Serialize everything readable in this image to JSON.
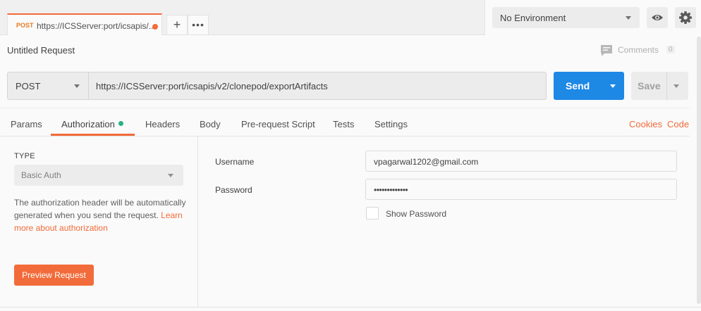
{
  "tab": {
    "method": "POST",
    "url": "https://ICSServer:port/icsapis/...",
    "unsaved_dot_color": "#f26b3a"
  },
  "tab_add_label": "+",
  "tab_more_label": "•••",
  "environment": {
    "selected": "No Environment"
  },
  "request": {
    "title": "Untitled Request",
    "comments_label": "Comments",
    "comments_count": "0",
    "method": "POST",
    "url": "https://ICSServer:port/icsapis/v2/clonepod/exportArtifacts",
    "send_label": "Send",
    "save_label": "Save"
  },
  "request_tabs": [
    {
      "label": "Params"
    },
    {
      "label": "Authorization"
    },
    {
      "label": "Headers"
    },
    {
      "label": "Body"
    },
    {
      "label": "Pre-request Script"
    },
    {
      "label": "Tests"
    },
    {
      "label": "Settings"
    }
  ],
  "active_tab": "Authorization",
  "right_links": {
    "cookies": "Cookies",
    "code": "Code"
  },
  "auth": {
    "type_label": "TYPE",
    "type_selected": "Basic Auth",
    "help_text": "The authorization header will be automatically generated when you send the request. ",
    "help_link": "Learn more about authorization",
    "preview_label": "Preview Request",
    "username_label": "Username",
    "username_value": "vpagarwal1202@gmail.com",
    "password_label": "Password",
    "password_value": "•••••••••••••",
    "show_password_label": "Show Password"
  },
  "colors": {
    "accent": "#f26b3a",
    "send_blue": "#1e88e5",
    "status_green": "#26b47f"
  }
}
